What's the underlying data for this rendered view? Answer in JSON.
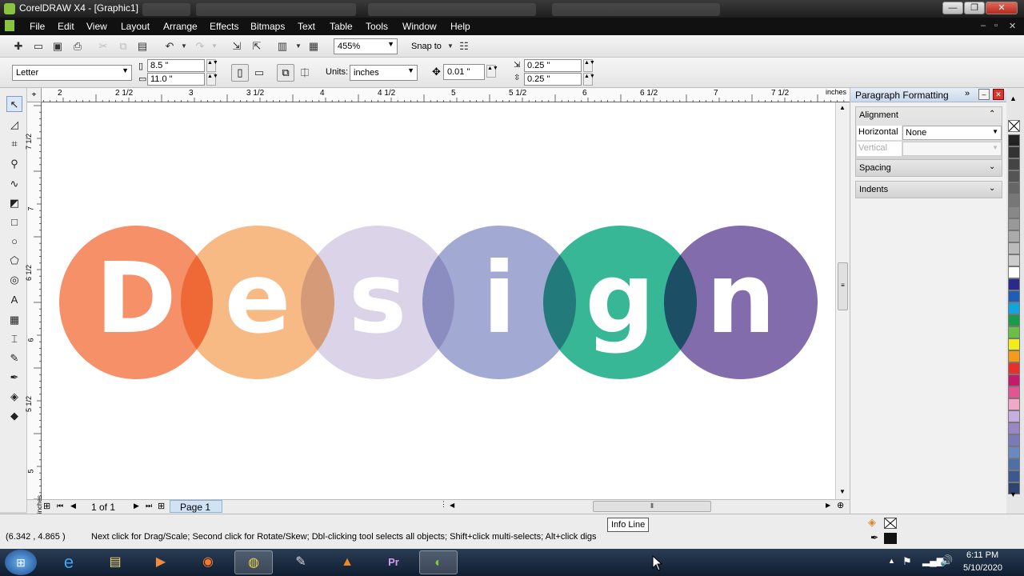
{
  "window": {
    "title": "CorelDRAW X4 - [Graphic1]"
  },
  "menu": [
    "File",
    "Edit",
    "View",
    "Layout",
    "Arrange",
    "Effects",
    "Bitmaps",
    "Text",
    "Table",
    "Tools",
    "Window",
    "Help"
  ],
  "toolbar": {
    "zoom": "455%",
    "snap_to": "Snap to"
  },
  "property_bar": {
    "page_size": "Letter",
    "width": "8.5 \"",
    "height": "11.0 \"",
    "units_label": "Units:",
    "units": "inches",
    "nudge": "0.01 \"",
    "dup_x": "0.25 \"",
    "dup_y": "0.25 \""
  },
  "ruler": {
    "top_labels": [
      "2",
      "2 1/2",
      "3",
      "3 1/2",
      "4",
      "4 1/2",
      "5",
      "5 1/2",
      "6",
      "6 1/2",
      "7",
      "7 1/2"
    ],
    "unit": "inches",
    "left_labels": [
      "7 1/2",
      "7",
      "6 1/2",
      "6",
      "5 1/2",
      "5"
    ]
  },
  "design": {
    "letters": [
      "D",
      "e",
      "s",
      "i",
      "g",
      "n"
    ],
    "colors": [
      "#f58a60",
      "#f7ae6e",
      "#d7d0e7",
      "#98a1cf",
      "#2cb38f",
      "#7b64a8"
    ]
  },
  "page_nav": {
    "page_count": "1 of 1",
    "page_tab": "Page 1"
  },
  "docker": {
    "title": "Paragraph Formatting",
    "alignment_label": "Alignment",
    "horizontal_label": "Horizontal",
    "horizontal_value": "None",
    "vertical_label": "Vertical",
    "spacing_label": "Spacing",
    "indents_label": "Indents"
  },
  "status": {
    "coords": "(6.342 , 4.865 )",
    "message": "Next click for Drag/Scale; Second click for Rotate/Skew; Dbl-clicking tool selects all objects; Shift+click multi-selects; Alt+click digs",
    "tooltip": "Info Line"
  },
  "taskbar": {
    "time": "6:11 PM",
    "date": "5/10/2020"
  },
  "palette_colors": [
    "#222222",
    "#333333",
    "#444444",
    "#555555",
    "#666666",
    "#777777",
    "#888888",
    "#999999",
    "#aaaaaa",
    "#bbbbbb",
    "#cccccc",
    "#ffffff",
    "#2a2a8a",
    "#1e5fb5",
    "#11a4de",
    "#1a9a4b",
    "#6abf45",
    "#f4ec18",
    "#f59b1a",
    "#e8302a",
    "#c5196e",
    "#e25590",
    "#f3a8c7",
    "#c8aee0",
    "#9a86c5",
    "#7a7ab8",
    "#6a88c2",
    "#4e6fa8",
    "#3d5890",
    "#2f436e"
  ]
}
